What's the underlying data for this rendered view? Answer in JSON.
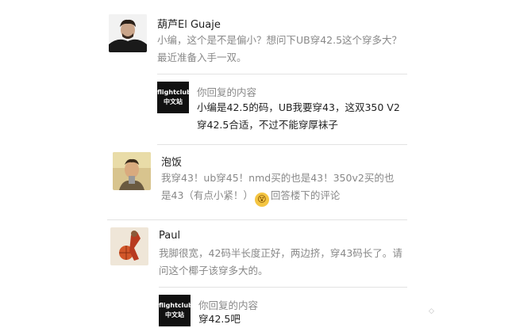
{
  "comments": [
    {
      "user": "葫芦El Guaje",
      "text": "小编，这个是不是偏小？想问下UB穿42.5这个穿多大？最近准备入手一双。",
      "reply": {
        "label": "你回复的内容",
        "logo_line1": "flightclub",
        "logo_line2": "中文站",
        "text": "小编是42.5的码，UB我要穿43，这双350 V2穿42.5合适，不过不能穿厚袜子"
      }
    },
    {
      "user": "泡饭",
      "text": "我穿43！ub穿45！nmd买的也是43！350v2买的也是43（有点小紧！）",
      "emoji_icon": "dizzy-face-icon",
      "text_after_emoji": "回答楼下的评论"
    },
    {
      "user": "Paul",
      "text": "我脚很宽，42码半长度正好，两边挤，穿43码长了。请问这个椰子该穿多大的。",
      "reply": {
        "label": "你回复的内容",
        "logo_line1": "flightclub",
        "logo_line2": "中文站",
        "text": "穿42.5吧"
      }
    }
  ],
  "colors": {
    "meta_text": "#888888",
    "body_text": "#222222",
    "divider": "#e3e3e3",
    "logo_bg": "#111111"
  }
}
